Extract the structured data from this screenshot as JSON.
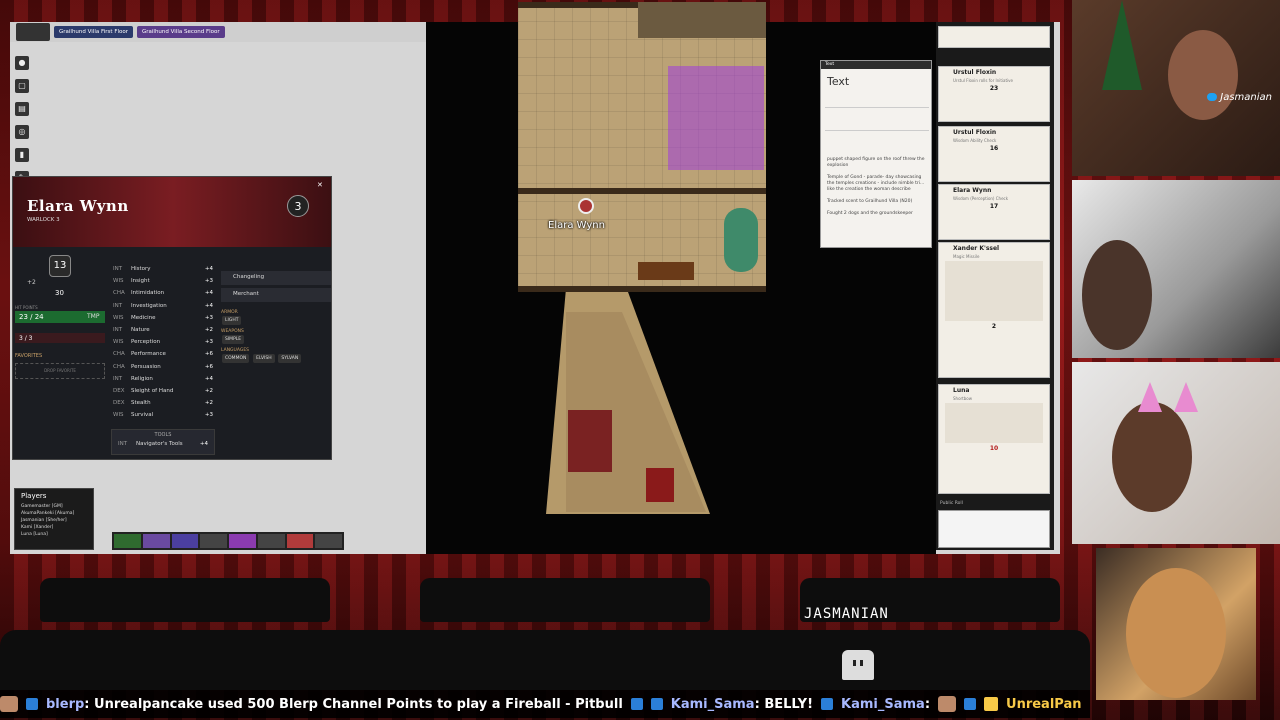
{
  "vtt": {
    "pages": [
      "Grailhund Villa First Floor",
      "Grailhund Villa Second Floor"
    ],
    "token_label": "Elara Wynn"
  },
  "sheet": {
    "name": "Elara Wynn",
    "class": "WARLOCK 3",
    "level": "3",
    "ac": "13",
    "hp": "23 / 24",
    "tmp_label": "TMP",
    "hit_dice": "3 / 3",
    "favorites_label": "FAVORITES",
    "drop_favorite": "DROP FAVORITE",
    "inspiration_label": "INSPIRATION",
    "speed": "30",
    "proficiency": "+2",
    "skills": [
      {
        "ab": "INT",
        "name": "History",
        "mod": "+4"
      },
      {
        "ab": "WIS",
        "name": "Insight",
        "mod": "+3"
      },
      {
        "ab": "CHA",
        "name": "Intimidation",
        "mod": "+4"
      },
      {
        "ab": "INT",
        "name": "Investigation",
        "mod": "+4"
      },
      {
        "ab": "WIS",
        "name": "Medicine",
        "mod": "+3"
      },
      {
        "ab": "INT",
        "name": "Nature",
        "mod": "+2"
      },
      {
        "ab": "WIS",
        "name": "Perception",
        "mod": "+3"
      },
      {
        "ab": "CHA",
        "name": "Performance",
        "mod": "+6"
      },
      {
        "ab": "CHA",
        "name": "Persuasion",
        "mod": "+6"
      },
      {
        "ab": "INT",
        "name": "Religion",
        "mod": "+4"
      },
      {
        "ab": "DEX",
        "name": "Sleight of Hand",
        "mod": "+2"
      },
      {
        "ab": "DEX",
        "name": "Stealth",
        "mod": "+2"
      },
      {
        "ab": "WIS",
        "name": "Survival",
        "mod": "+3"
      }
    ],
    "tools_label": "TOOLS",
    "tool": {
      "ab": "INT",
      "name": "Navigator's Tools",
      "mod": "+4"
    },
    "race": "Changeling",
    "background": "Merchant",
    "armor_label": "ARMOR",
    "armor": [
      "LIGHT"
    ],
    "weapons_label": "WEAPONS",
    "weapons": [
      "SIMPLE"
    ],
    "languages_label": "LANGUAGES",
    "languages": [
      "COMMON",
      "ELVISH",
      "SYLVAN"
    ]
  },
  "players": {
    "title": "Players",
    "list": [
      "Gamemaster [GM]",
      "AkumaPankeki [Akuma]",
      "Jasmanian [She/her]",
      "Kami [Xander]",
      "Luna [Luna]"
    ]
  },
  "text_popup": {
    "title": "Text",
    "body": [
      "puppet shaped figure on the roof threw the explosion",
      "Temple of Gond - parade- day showcasing the temples creations - include nimble tri... like the creation the woman describe",
      "Tracked scent to Grailhund Villa (N20)",
      "Fought 2 dogs and the groundskeeper"
    ]
  },
  "chat": {
    "cards": [
      {
        "who": "Urstul Floxin",
        "sub": "Urstul Floxin rolls for Initiative",
        "result": "23"
      },
      {
        "who": "Urstul Floxin",
        "sub": "Wisdom Ability Check",
        "result": "16"
      },
      {
        "who": "Elara Wynn",
        "sub": "Wisdom (Perception) Check",
        "result": "17"
      },
      {
        "who": "Xander K'ssel",
        "sub": "Magic Missile",
        "result": "2"
      },
      {
        "who": "Luna",
        "sub": "Shortbow",
        "result": "10"
      }
    ],
    "roll_mode": "Public Roll"
  },
  "cams": {
    "handle": "Jasmanian"
  },
  "overlay": {
    "name_tag": "JASMANIAN"
  },
  "ticker": [
    {
      "user": "blerp",
      "msg": ": Unrealpancake used 500 Blerp Channel Points to play a Fireball - Pitbull",
      "gold": false
    },
    {
      "user": "Kami_Sama",
      "msg": ": BELLY!",
      "gold": false
    },
    {
      "user": "Kami_Sama",
      "msg": ":",
      "gold": false
    },
    {
      "user": "UnrealPan",
      "msg": "",
      "gold": true
    }
  ],
  "colors": {
    "curtain": "#8e1616",
    "sheet_header": "#7a1d22",
    "hp_green": "#1c6b30",
    "ticker_user": "#a8b9ff",
    "roll_red": "#b21919"
  }
}
